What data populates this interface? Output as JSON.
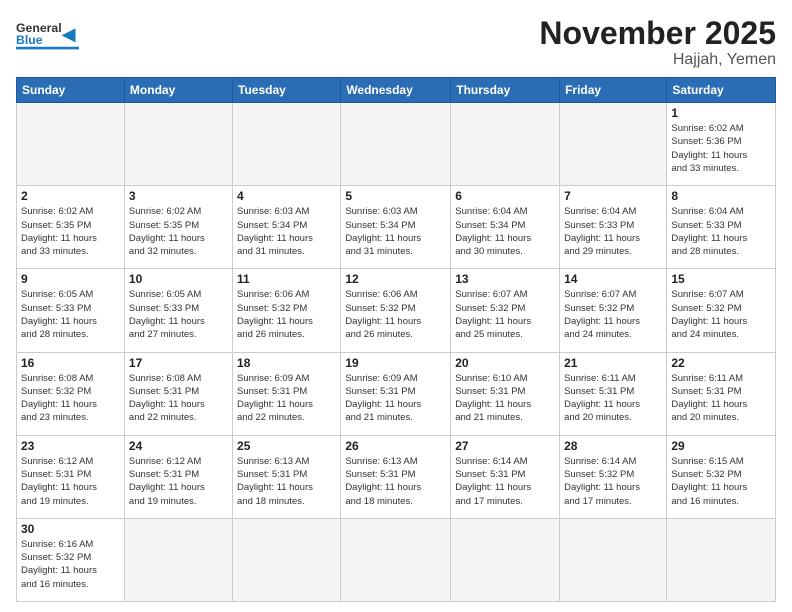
{
  "header": {
    "logo_general": "General",
    "logo_blue": "Blue",
    "month_title": "November 2025",
    "location": "Hajjah, Yemen"
  },
  "days_of_week": [
    "Sunday",
    "Monday",
    "Tuesday",
    "Wednesday",
    "Thursday",
    "Friday",
    "Saturday"
  ],
  "weeks": [
    [
      {
        "day": "",
        "info": ""
      },
      {
        "day": "",
        "info": ""
      },
      {
        "day": "",
        "info": ""
      },
      {
        "day": "",
        "info": ""
      },
      {
        "day": "",
        "info": ""
      },
      {
        "day": "",
        "info": ""
      },
      {
        "day": "1",
        "info": "Sunrise: 6:02 AM\nSunset: 5:36 PM\nDaylight: 11 hours\nand 33 minutes."
      }
    ],
    [
      {
        "day": "2",
        "info": "Sunrise: 6:02 AM\nSunset: 5:35 PM\nDaylight: 11 hours\nand 33 minutes."
      },
      {
        "day": "3",
        "info": "Sunrise: 6:02 AM\nSunset: 5:35 PM\nDaylight: 11 hours\nand 32 minutes."
      },
      {
        "day": "4",
        "info": "Sunrise: 6:03 AM\nSunset: 5:34 PM\nDaylight: 11 hours\nand 31 minutes."
      },
      {
        "day": "5",
        "info": "Sunrise: 6:03 AM\nSunset: 5:34 PM\nDaylight: 11 hours\nand 31 minutes."
      },
      {
        "day": "6",
        "info": "Sunrise: 6:04 AM\nSunset: 5:34 PM\nDaylight: 11 hours\nand 30 minutes."
      },
      {
        "day": "7",
        "info": "Sunrise: 6:04 AM\nSunset: 5:33 PM\nDaylight: 11 hours\nand 29 minutes."
      },
      {
        "day": "8",
        "info": "Sunrise: 6:04 AM\nSunset: 5:33 PM\nDaylight: 11 hours\nand 28 minutes."
      }
    ],
    [
      {
        "day": "9",
        "info": "Sunrise: 6:05 AM\nSunset: 5:33 PM\nDaylight: 11 hours\nand 28 minutes."
      },
      {
        "day": "10",
        "info": "Sunrise: 6:05 AM\nSunset: 5:33 PM\nDaylight: 11 hours\nand 27 minutes."
      },
      {
        "day": "11",
        "info": "Sunrise: 6:06 AM\nSunset: 5:32 PM\nDaylight: 11 hours\nand 26 minutes."
      },
      {
        "day": "12",
        "info": "Sunrise: 6:06 AM\nSunset: 5:32 PM\nDaylight: 11 hours\nand 26 minutes."
      },
      {
        "day": "13",
        "info": "Sunrise: 6:07 AM\nSunset: 5:32 PM\nDaylight: 11 hours\nand 25 minutes."
      },
      {
        "day": "14",
        "info": "Sunrise: 6:07 AM\nSunset: 5:32 PM\nDaylight: 11 hours\nand 24 minutes."
      },
      {
        "day": "15",
        "info": "Sunrise: 6:07 AM\nSunset: 5:32 PM\nDaylight: 11 hours\nand 24 minutes."
      }
    ],
    [
      {
        "day": "16",
        "info": "Sunrise: 6:08 AM\nSunset: 5:32 PM\nDaylight: 11 hours\nand 23 minutes."
      },
      {
        "day": "17",
        "info": "Sunrise: 6:08 AM\nSunset: 5:31 PM\nDaylight: 11 hours\nand 22 minutes."
      },
      {
        "day": "18",
        "info": "Sunrise: 6:09 AM\nSunset: 5:31 PM\nDaylight: 11 hours\nand 22 minutes."
      },
      {
        "day": "19",
        "info": "Sunrise: 6:09 AM\nSunset: 5:31 PM\nDaylight: 11 hours\nand 21 minutes."
      },
      {
        "day": "20",
        "info": "Sunrise: 6:10 AM\nSunset: 5:31 PM\nDaylight: 11 hours\nand 21 minutes."
      },
      {
        "day": "21",
        "info": "Sunrise: 6:11 AM\nSunset: 5:31 PM\nDaylight: 11 hours\nand 20 minutes."
      },
      {
        "day": "22",
        "info": "Sunrise: 6:11 AM\nSunset: 5:31 PM\nDaylight: 11 hours\nand 20 minutes."
      }
    ],
    [
      {
        "day": "23",
        "info": "Sunrise: 6:12 AM\nSunset: 5:31 PM\nDaylight: 11 hours\nand 19 minutes."
      },
      {
        "day": "24",
        "info": "Sunrise: 6:12 AM\nSunset: 5:31 PM\nDaylight: 11 hours\nand 19 minutes."
      },
      {
        "day": "25",
        "info": "Sunrise: 6:13 AM\nSunset: 5:31 PM\nDaylight: 11 hours\nand 18 minutes."
      },
      {
        "day": "26",
        "info": "Sunrise: 6:13 AM\nSunset: 5:31 PM\nDaylight: 11 hours\nand 18 minutes."
      },
      {
        "day": "27",
        "info": "Sunrise: 6:14 AM\nSunset: 5:31 PM\nDaylight: 11 hours\nand 17 minutes."
      },
      {
        "day": "28",
        "info": "Sunrise: 6:14 AM\nSunset: 5:32 PM\nDaylight: 11 hours\nand 17 minutes."
      },
      {
        "day": "29",
        "info": "Sunrise: 6:15 AM\nSunset: 5:32 PM\nDaylight: 11 hours\nand 16 minutes."
      }
    ],
    [
      {
        "day": "30",
        "info": "Sunrise: 6:16 AM\nSunset: 5:32 PM\nDaylight: 11 hours\nand 16 minutes."
      },
      {
        "day": "",
        "info": ""
      },
      {
        "day": "",
        "info": ""
      },
      {
        "day": "",
        "info": ""
      },
      {
        "day": "",
        "info": ""
      },
      {
        "day": "",
        "info": ""
      },
      {
        "day": "",
        "info": ""
      }
    ]
  ]
}
